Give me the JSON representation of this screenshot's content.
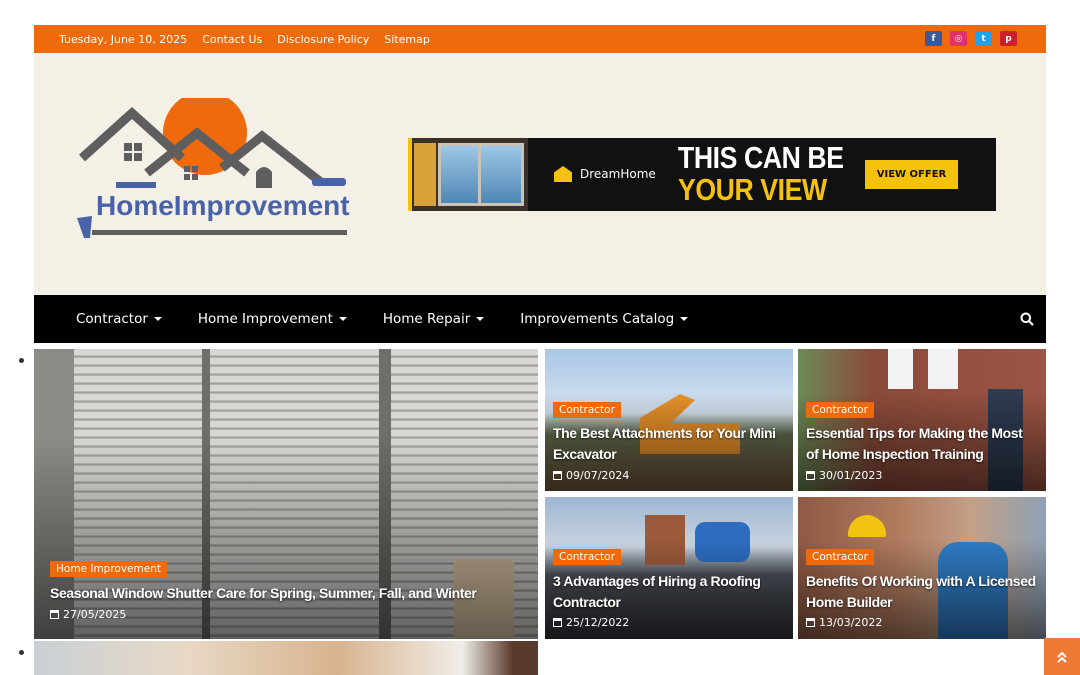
{
  "topbar": {
    "date": "Tuesday, June 10, 2025",
    "links": [
      "Contact Us",
      "Disclosure Policy",
      "Sitemap"
    ],
    "social": [
      {
        "icon": "facebook-icon",
        "glyph": "f",
        "color": "#3b5998"
      },
      {
        "icon": "instagram-icon",
        "glyph": "◎",
        "color": "#e1306c"
      },
      {
        "icon": "twitter-icon",
        "glyph": "t",
        "color": "#1da1f2"
      },
      {
        "icon": "pinterest-icon",
        "glyph": "p",
        "color": "#cb2027"
      }
    ]
  },
  "logo": {
    "text": "HomeImprovement"
  },
  "banner": {
    "brand": "DreamHome",
    "headline_line1": "THIS CAN BE",
    "headline_line2": "YOUR VIEW",
    "cta": "VIEW OFFER"
  },
  "nav": {
    "items": [
      "Contractor",
      "Home Improvement",
      "Home Repair",
      "Improvements Catalog"
    ],
    "search_icon": "search-icon"
  },
  "posts": [
    {
      "category": "Home Improvement",
      "title": "Seasonal Window Shutter Care for Spring, Summer, Fall, and Winter",
      "date": "27/05/2025"
    },
    {
      "category": "Contractor",
      "title": "The Best Attachments for Your Mini Excavator",
      "date": "09/07/2024"
    },
    {
      "category": "Contractor",
      "title": "Essential Tips for Making the Most of Home Inspection Training",
      "date": "30/01/2023"
    },
    {
      "category": "Contractor",
      "title": "3 Advantages of Hiring a Roofing Contractor",
      "date": "25/12/2022"
    },
    {
      "category": "Contractor",
      "title": "Benefits Of Working with A Licensed Home Builder",
      "date": "13/03/2022"
    }
  ],
  "colors": {
    "accent": "#ef6a0d",
    "nav_bg": "#000000",
    "header_bg": "#f4f0e6"
  }
}
